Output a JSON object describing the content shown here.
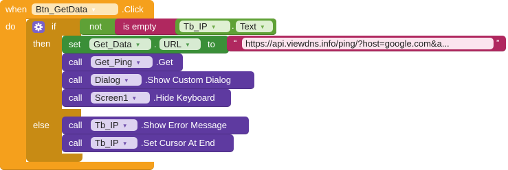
{
  "colors": {
    "event": "#f5a01c",
    "control": "#c88b14",
    "logic": "#5fa136",
    "text": "#b0285f",
    "component_set": "#3a8f38",
    "component_call": "#5e3aa0",
    "gear": "#7a62c8"
  },
  "event_block": {
    "when_label": "when",
    "component": "Btn_GetData",
    "event": ".Click",
    "do_label": "do"
  },
  "if_block": {
    "gear_icon": "gear-icon",
    "if_label": "if",
    "then_label": "then",
    "else_label": "else"
  },
  "condition": {
    "not_label": "not",
    "is_empty_label": "is empty",
    "component": "Tb_IP",
    "property": "Text"
  },
  "then_statements": {
    "set_label": "set",
    "set_component": "Get_Data",
    "set_property": "URL",
    "to_label": "to",
    "url_text": "https://api.viewdns.info/ping/?host=google.com&a...",
    "calls": [
      {
        "call_label": "call",
        "component": "Get_Ping",
        "method": ".Get"
      },
      {
        "call_label": "call",
        "component": "Dialog",
        "method": ".Show Custom Dialog"
      },
      {
        "call_label": "call",
        "component": "Screen1",
        "method": ".Hide Keyboard"
      }
    ]
  },
  "else_statements": {
    "calls": [
      {
        "call_label": "call",
        "component": "Tb_IP",
        "method": ".Show Error Message"
      },
      {
        "call_label": "call",
        "component": "Tb_IP",
        "method": ".Set Cursor At End"
      }
    ]
  },
  "quote_open": "“",
  "quote_close": "”",
  "dropdown_arrow": "▼"
}
